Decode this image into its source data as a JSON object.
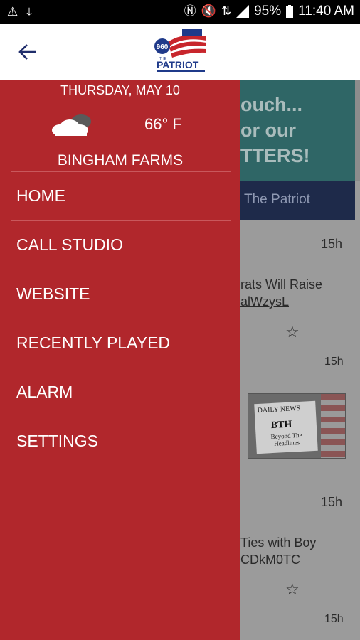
{
  "status_bar": {
    "battery": "95%",
    "time": "11:40 AM"
  },
  "app_bar": {
    "logo_number": "960",
    "logo_the": "THE",
    "logo_name": "PATRIOT"
  },
  "background": {
    "banner_lines": [
      "ouch...",
      "or our",
      "TTERS!"
    ],
    "tab_label": "The Patriot",
    "posts": [
      {
        "time": "15h",
        "line1": "rats Will Raise",
        "line2": "alWzysL"
      },
      {
        "time": "15h"
      },
      {
        "time": "15h",
        "line1": "Ties with Boy",
        "line2": "CDkM0TC"
      },
      {
        "time": "15h"
      }
    ],
    "thumbnail": {
      "title": "DAILY NEWS",
      "bth": "BTH",
      "subtitle": "Beyond The Headlines"
    }
  },
  "drawer": {
    "date": "THURSDAY, MAY 10",
    "weather_icon": "cloudy-icon",
    "temperature": "66° F",
    "location": "BINGHAM FARMS",
    "menu": [
      {
        "label": "HOME"
      },
      {
        "label": "CALL STUDIO"
      },
      {
        "label": "WEBSITE"
      },
      {
        "label": "RECENTLY PLAYED"
      },
      {
        "label": "ALARM"
      },
      {
        "label": "SETTINGS"
      }
    ]
  }
}
